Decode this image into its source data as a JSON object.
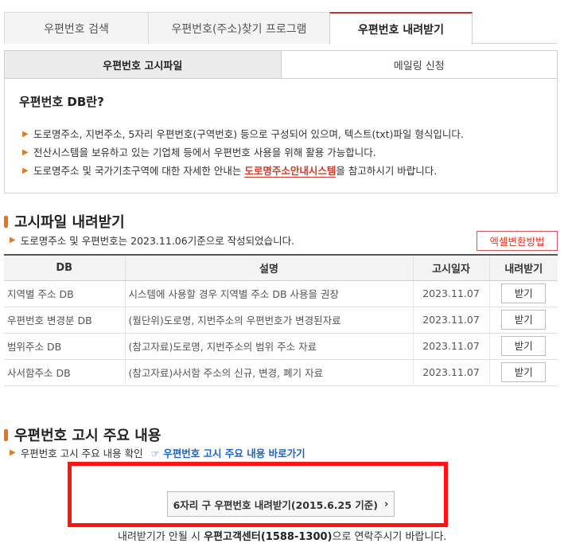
{
  "top_tabs": [
    {
      "label": "우편번호 검색"
    },
    {
      "label": "우편번호(주소)찾기 프로그램"
    },
    {
      "label": "우편번호 내려받기"
    }
  ],
  "sub_tabs": [
    {
      "label": "우편번호 고시파일"
    },
    {
      "label": "메일링 신청"
    }
  ],
  "info": {
    "title": "우편번호 DB란?",
    "bullet1": "도로명주소, 지번주소, 5자리 우편번호(구역번호) 등으로 구성되어 있으며, 텍스트(txt)파일 형식입니다.",
    "bullet2": "전산시스템을 보유하고 있는 기업체 등에서 우편번호 사용을 위해 활용 가능합니다.",
    "bullet3_pre": "도로명주소 및 국가기초구역에 대한 자세한 안내는 ",
    "bullet3_link": "도로명주소안내시스템",
    "bullet3_post": "을 참고하시기 바랍니다."
  },
  "download_section": {
    "heading": "고시파일 내려받기",
    "note": "도로명주소 및 우편번호는 2023.11.06기준으로 작성되었습니다.",
    "excel_button": "엑셀변환방법",
    "columns": [
      "DB",
      "설명",
      "고시일자",
      "내려받기"
    ],
    "rows": [
      {
        "db": "지역별 주소 DB",
        "desc": "시스템에 사용할 경우 지역별 주소 DB 사용을 권장",
        "date": "2023.11.07",
        "action": "받기"
      },
      {
        "db": "우편번호 변경분 DB",
        "desc": "(월단위)도로명, 지번주소의 우편번호가 변경된자료",
        "date": "2023.11.07",
        "action": "받기"
      },
      {
        "db": "범위주소 DB",
        "desc": "(참고자료)도로명, 지번주소의 범위 주소 자료",
        "date": "2023.11.07",
        "action": "받기"
      },
      {
        "db": "사서함주소 DB",
        "desc": "(참고자료)사서함 주소의 신규, 변경, 폐기 자료",
        "date": "2023.11.07",
        "action": "받기"
      }
    ]
  },
  "notice_section": {
    "heading": "우편번호 고시 주요 내용",
    "note": "우편번호 고시 주요 내용 확인",
    "shortcut_icon": "☞",
    "shortcut_label": "우편번호 고시 주요 내용 바로가기",
    "old_download_button": "6자리 구 우편번호 내려받기(2015.6.25 기준)",
    "contact_pre": "내려받기가 안될 시 ",
    "contact_bold": "우편고객센터(1588-1300)",
    "contact_post": "으로 연락주시기 바랍니다."
  },
  "colors": {
    "accent_orange": "#e8731a",
    "active_tab_border": "#c0392b",
    "link_red": "#d63a2a",
    "link_blue": "#1a64c8",
    "highlight_red": "#ff1414"
  }
}
